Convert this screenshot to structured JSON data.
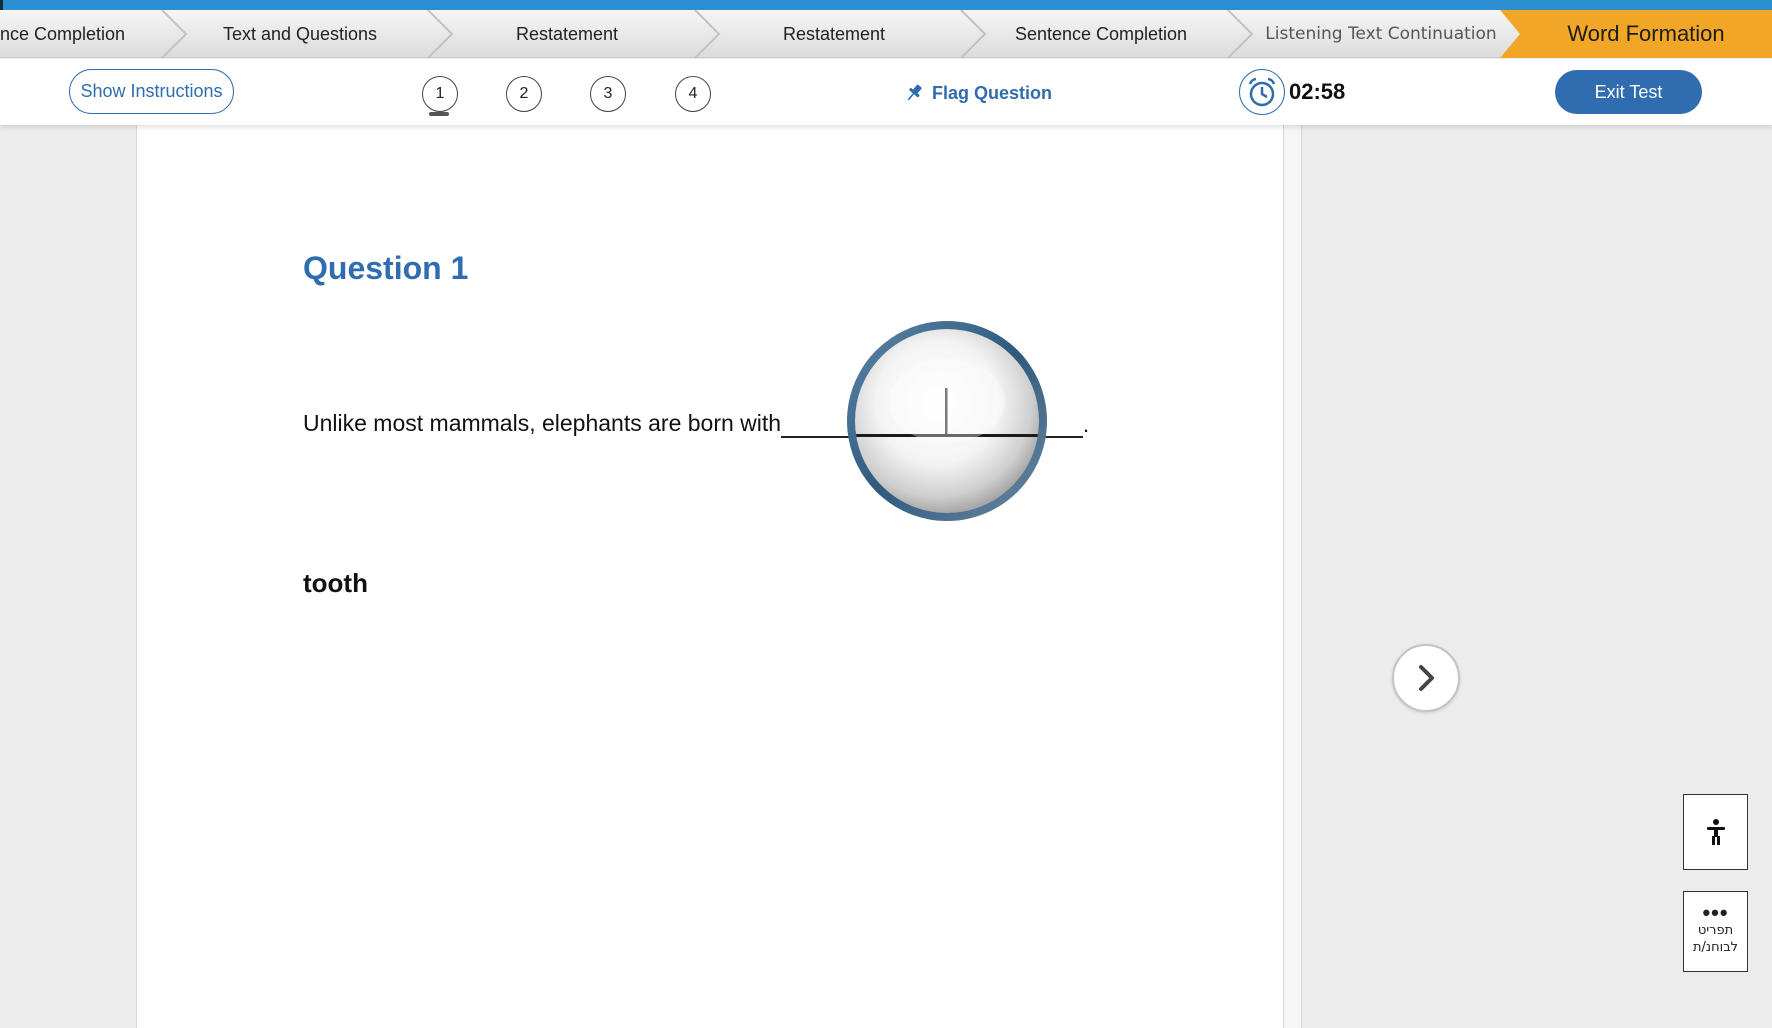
{
  "steps": [
    {
      "label": "nce Completion"
    },
    {
      "label": "Text and Questions"
    },
    {
      "label": "Restatement"
    },
    {
      "label": "Restatement"
    },
    {
      "label": "Sentence Completion"
    },
    {
      "label": "Listening Text Continuation"
    },
    {
      "label": "Word Formation",
      "active": true
    }
  ],
  "toolbar": {
    "show_instructions": "Show Instructions",
    "questions": [
      "1",
      "2",
      "3",
      "4"
    ],
    "current_question": "1",
    "flag_label": "Flag Question",
    "timer": "02:58",
    "exit_label": "Exit Test"
  },
  "question": {
    "title": "Question 1",
    "sentence": "Unlike most mammals, elephants are born with",
    "end_punct": ".",
    "word": "tooth"
  },
  "side": {
    "menu_label_line1": "תפריט",
    "menu_label_line2": "לבוחנ/ת"
  },
  "colors": {
    "accent": "#2f6db0",
    "active_step": "#f1a628",
    "top_bar": "#2b8fd0"
  },
  "icons": [
    "pin-icon",
    "alarm-clock-icon",
    "chevron-right-icon",
    "accessibility-icon",
    "more-dots-icon",
    "magnifier-lens"
  ]
}
